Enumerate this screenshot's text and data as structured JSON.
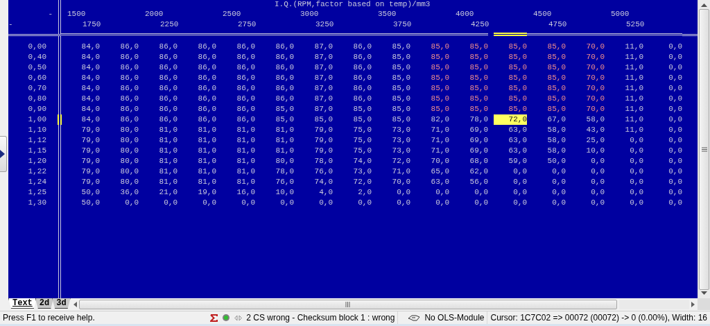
{
  "map": {
    "title": "I.Q.(RPM,factor based on temp)/mm3",
    "corner_top": "-",
    "corner_bottom": "-",
    "columns": [
      {
        "label": "1500",
        "selected": false
      },
      {
        "label": "1750",
        "selected": false
      },
      {
        "label": "2000",
        "selected": false
      },
      {
        "label": "2250",
        "selected": false
      },
      {
        "label": "2500",
        "selected": false
      },
      {
        "label": "2750",
        "selected": false
      },
      {
        "label": "3000",
        "selected": false
      },
      {
        "label": "3250",
        "selected": false
      },
      {
        "label": "3500",
        "selected": false
      },
      {
        "label": "3750",
        "selected": false
      },
      {
        "label": "4000",
        "selected": false
      },
      {
        "label": "4250",
        "selected": true
      },
      {
        "label": "4500",
        "selected": false
      },
      {
        "label": "4750",
        "selected": false
      },
      {
        "label": "5000",
        "selected": false
      },
      {
        "label": "5250",
        "selected": false
      }
    ],
    "rows": [
      {
        "label": "0,00",
        "selected": false,
        "values": [
          "84,0",
          "86,0",
          "86,0",
          "86,0",
          "86,0",
          "86,0",
          "87,0",
          "86,0",
          "85,0",
          "85,0",
          "85,0",
          "85,0",
          "85,0",
          "70,0",
          "11,0",
          "0,0"
        ],
        "flagged": [
          false,
          false,
          false,
          false,
          false,
          false,
          false,
          false,
          false,
          true,
          true,
          true,
          true,
          true,
          false,
          false
        ]
      },
      {
        "label": "0,40",
        "selected": false,
        "values": [
          "84,0",
          "86,0",
          "86,0",
          "86,0",
          "86,0",
          "86,0",
          "87,0",
          "86,0",
          "85,0",
          "85,0",
          "85,0",
          "85,0",
          "85,0",
          "70,0",
          "11,0",
          "0,0"
        ],
        "flagged": [
          false,
          false,
          false,
          false,
          false,
          false,
          false,
          false,
          false,
          true,
          true,
          true,
          true,
          true,
          false,
          false
        ]
      },
      {
        "label": "0,50",
        "selected": false,
        "values": [
          "84,0",
          "86,0",
          "86,0",
          "86,0",
          "86,0",
          "86,0",
          "87,0",
          "86,0",
          "85,0",
          "85,0",
          "85,0",
          "85,0",
          "85,0",
          "70,0",
          "11,0",
          "0,0"
        ],
        "flagged": [
          false,
          false,
          false,
          false,
          false,
          false,
          false,
          false,
          false,
          true,
          true,
          true,
          true,
          true,
          false,
          false
        ]
      },
      {
        "label": "0,60",
        "selected": false,
        "values": [
          "84,0",
          "86,0",
          "86,0",
          "86,0",
          "86,0",
          "86,0",
          "87,0",
          "86,0",
          "85,0",
          "85,0",
          "85,0",
          "85,0",
          "85,0",
          "70,0",
          "11,0",
          "0,0"
        ],
        "flagged": [
          false,
          false,
          false,
          false,
          false,
          false,
          false,
          false,
          false,
          true,
          true,
          true,
          true,
          true,
          false,
          false
        ]
      },
      {
        "label": "0,70",
        "selected": false,
        "values": [
          "84,0",
          "86,0",
          "86,0",
          "86,0",
          "86,0",
          "86,0",
          "87,0",
          "86,0",
          "85,0",
          "85,0",
          "85,0",
          "85,0",
          "85,0",
          "70,0",
          "11,0",
          "0,0"
        ],
        "flagged": [
          false,
          false,
          false,
          false,
          false,
          false,
          false,
          false,
          false,
          true,
          true,
          true,
          true,
          true,
          false,
          false
        ]
      },
      {
        "label": "0,80",
        "selected": false,
        "values": [
          "84,0",
          "86,0",
          "86,0",
          "86,0",
          "86,0",
          "86,0",
          "87,0",
          "86,0",
          "85,0",
          "85,0",
          "85,0",
          "85,0",
          "85,0",
          "70,0",
          "11,0",
          "0,0"
        ],
        "flagged": [
          false,
          false,
          false,
          false,
          false,
          false,
          false,
          false,
          false,
          true,
          true,
          true,
          true,
          true,
          false,
          false
        ]
      },
      {
        "label": "0,90",
        "selected": false,
        "values": [
          "84,0",
          "86,0",
          "86,0",
          "86,0",
          "86,0",
          "85,0",
          "87,0",
          "85,0",
          "85,0",
          "85,0",
          "85,0",
          "85,0",
          "85,0",
          "70,0",
          "11,0",
          "0,0"
        ],
        "flagged": [
          false,
          false,
          false,
          false,
          false,
          false,
          false,
          false,
          false,
          true,
          true,
          true,
          true,
          true,
          false,
          false
        ]
      },
      {
        "label": "1,00",
        "selected": true,
        "values": [
          "84,0",
          "86,0",
          "86,0",
          "86,0",
          "86,0",
          "85,0",
          "85,0",
          "85,0",
          "85,0",
          "82,0",
          "78,0",
          "72,0",
          "67,0",
          "58,0",
          "11,0",
          "0,0"
        ],
        "flagged": [
          false,
          false,
          false,
          false,
          false,
          false,
          false,
          false,
          false,
          false,
          false,
          false,
          false,
          false,
          false,
          false
        ]
      },
      {
        "label": "1,10",
        "selected": false,
        "values": [
          "79,0",
          "80,0",
          "81,0",
          "81,0",
          "81,0",
          "81,0",
          "79,0",
          "75,0",
          "73,0",
          "71,0",
          "69,0",
          "63,0",
          "58,0",
          "43,0",
          "11,0",
          "0,0"
        ],
        "flagged": [
          false,
          false,
          false,
          false,
          false,
          false,
          false,
          false,
          false,
          false,
          false,
          false,
          false,
          false,
          false,
          false
        ]
      },
      {
        "label": "1,12",
        "selected": false,
        "values": [
          "79,0",
          "80,0",
          "81,0",
          "81,0",
          "81,0",
          "81,0",
          "79,0",
          "75,0",
          "73,0",
          "71,0",
          "69,0",
          "63,0",
          "58,0",
          "25,0",
          "0,0",
          "0,0"
        ],
        "flagged": [
          false,
          false,
          false,
          false,
          false,
          false,
          false,
          false,
          false,
          false,
          false,
          false,
          false,
          false,
          false,
          false
        ]
      },
      {
        "label": "1,15",
        "selected": false,
        "values": [
          "79,0",
          "80,0",
          "81,0",
          "81,0",
          "81,0",
          "81,0",
          "79,0",
          "75,0",
          "73,0",
          "71,0",
          "69,0",
          "63,0",
          "58,0",
          "10,0",
          "0,0",
          "0,0"
        ],
        "flagged": [
          false,
          false,
          false,
          false,
          false,
          false,
          false,
          false,
          false,
          false,
          false,
          false,
          false,
          false,
          false,
          false
        ]
      },
      {
        "label": "1,20",
        "selected": false,
        "values": [
          "79,0",
          "80,0",
          "81,0",
          "81,0",
          "81,0",
          "80,0",
          "78,0",
          "74,0",
          "72,0",
          "70,0",
          "68,0",
          "59,0",
          "50,0",
          "0,0",
          "0,0",
          "0,0"
        ],
        "flagged": [
          false,
          false,
          false,
          false,
          false,
          false,
          false,
          false,
          false,
          false,
          false,
          false,
          false,
          false,
          false,
          false
        ]
      },
      {
        "label": "1,22",
        "selected": false,
        "values": [
          "79,0",
          "80,0",
          "81,0",
          "81,0",
          "81,0",
          "78,0",
          "76,0",
          "73,0",
          "71,0",
          "65,0",
          "62,0",
          "0,0",
          "0,0",
          "0,0",
          "0,0",
          "0,0"
        ],
        "flagged": [
          false,
          false,
          false,
          false,
          false,
          false,
          false,
          false,
          false,
          false,
          false,
          false,
          false,
          false,
          false,
          false
        ]
      },
      {
        "label": "1,24",
        "selected": false,
        "values": [
          "79,0",
          "80,0",
          "81,0",
          "81,0",
          "81,0",
          "76,0",
          "74,0",
          "72,0",
          "70,0",
          "63,0",
          "56,0",
          "0,0",
          "0,0",
          "0,0",
          "0,0",
          "0,0"
        ],
        "flagged": [
          false,
          false,
          false,
          false,
          false,
          false,
          false,
          false,
          false,
          false,
          false,
          false,
          false,
          false,
          false,
          false
        ]
      },
      {
        "label": "1,25",
        "selected": false,
        "values": [
          "50,0",
          "36,0",
          "21,0",
          "19,0",
          "16,0",
          "10,0",
          "4,0",
          "2,0",
          "0,0",
          "0,0",
          "0,0",
          "0,0",
          "0,0",
          "0,0",
          "0,0",
          "0,0"
        ],
        "flagged": [
          false,
          false,
          false,
          false,
          false,
          false,
          false,
          false,
          false,
          false,
          false,
          false,
          false,
          false,
          false,
          false
        ]
      },
      {
        "label": "1,30",
        "selected": false,
        "values": [
          "50,0",
          "0,0",
          "0,0",
          "0,0",
          "0,0",
          "0,0",
          "0,0",
          "0,0",
          "0,0",
          "0,0",
          "0,0",
          "0,0",
          "0,0",
          "0,0",
          "0,0",
          "0,0"
        ],
        "flagged": [
          false,
          false,
          false,
          false,
          false,
          false,
          false,
          false,
          false,
          false,
          false,
          false,
          false,
          false,
          false,
          false
        ]
      }
    ]
  },
  "view_tabs": [
    {
      "label": "Text",
      "selected": true
    },
    {
      "label": "2d",
      "selected": false
    },
    {
      "label": "3d",
      "selected": false
    }
  ],
  "status_bar": {
    "help": "Press F1 to receive help.",
    "checksum": "2 CS wrong - Checksum block 1 : wrong",
    "module": "No OLS-Module",
    "cursor": "Cursor: 1C7C02 => 00072 (00072) -> 0 (0.00%), Width: 16"
  }
}
